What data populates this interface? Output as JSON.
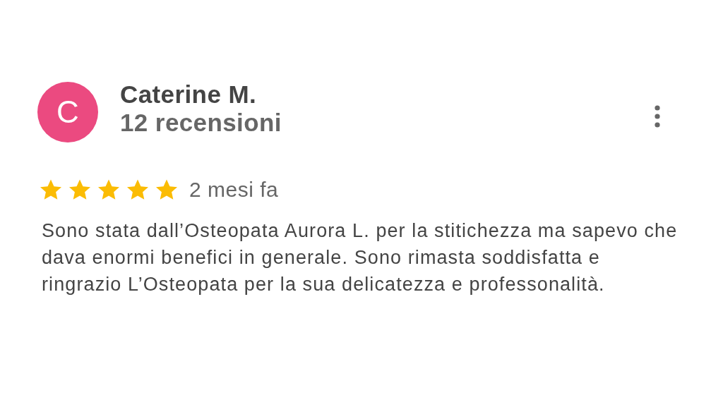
{
  "review": {
    "avatar_letter": "C",
    "color": "#eb4a80",
    "author": "Caterine M.",
    "reviews_count": "12 recensioni",
    "stars": 5,
    "time": "2 mesi fa",
    "text": "Sono stata dall’Osteopata Aurora L. per la stitichezza ma sapevo che dava enormi benefici in generale. Sono rimasta soddisfatta e ringrazio L’Osteopata per la sua delicatezza e professonalità."
  }
}
